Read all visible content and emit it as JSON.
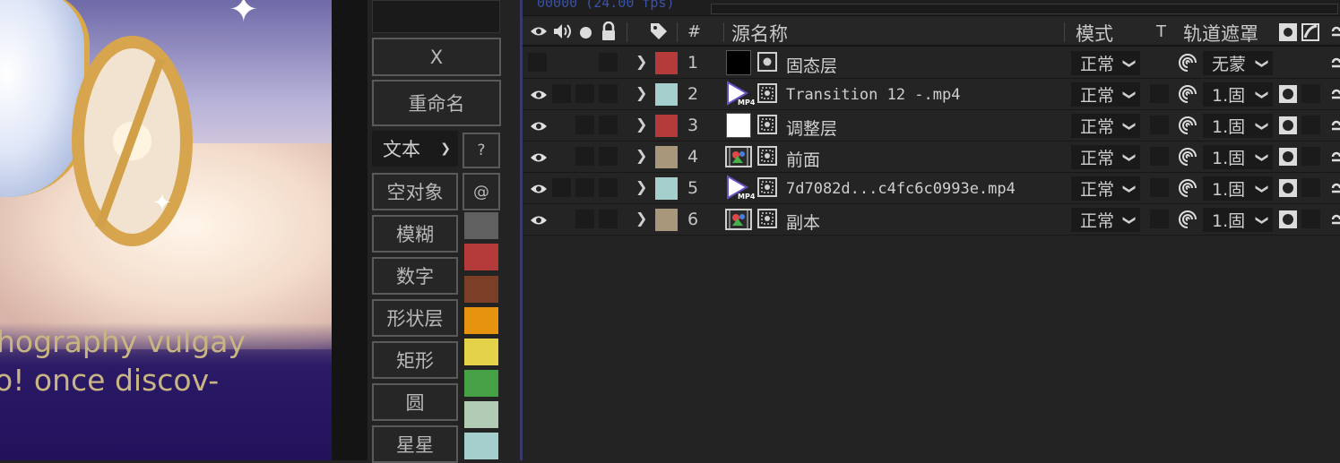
{
  "preview": {
    "overlay_line1": "hography vulgay",
    "overlay_line2": "o! once discov-"
  },
  "tools": {
    "x_label": "X",
    "rename_label": "重命名",
    "text_label": "文本",
    "help_label": "?",
    "at_label": "@",
    "null_label": "空对象",
    "blur_label": "模糊",
    "number_label": "数字",
    "shape_label": "形状层",
    "rect_label": "矩形",
    "circle_label": "圆",
    "star_label": "星星",
    "colors": [
      "#606060",
      "#b53a3a",
      "#7a3f26",
      "#e6930f",
      "#e3d24a",
      "#45a046",
      "#b2cbb4",
      "#a5cfcd"
    ]
  },
  "timeline": {
    "fps_text": "00000 (24.00 fps)",
    "headers": {
      "hash": "#",
      "source_name": "源名称",
      "mode": "模式",
      "t": "T",
      "track_matte": "轨道遮罩"
    },
    "layers": [
      {
        "num": "1",
        "name": "固态层",
        "label_color": "#b53a3a",
        "source": "solid-black",
        "mode": "正常",
        "matte": "无蒙",
        "visible": false,
        "mono": false
      },
      {
        "num": "2",
        "name": "Transition 12 -.mp4",
        "label_color": "#a5cfcd",
        "source": "mp4",
        "mode": "正常",
        "matte": "1.固",
        "visible": true,
        "mono": true
      },
      {
        "num": "3",
        "name": "调整层",
        "label_color": "#b53a3a",
        "source": "solid-white",
        "mode": "正常",
        "matte": "1.固",
        "visible": true,
        "mono": false
      },
      {
        "num": "4",
        "name": "前面",
        "label_color": "#a8977a",
        "source": "image",
        "mode": "正常",
        "matte": "1.固",
        "visible": true,
        "mono": false
      },
      {
        "num": "5",
        "name": "7d7082d...c4fc6c0993e.mp4",
        "label_color": "#a5cfcd",
        "source": "mp4",
        "mode": "正常",
        "matte": "1.固",
        "visible": true,
        "mono": true
      },
      {
        "num": "6",
        "name": "副本",
        "label_color": "#a8977a",
        "source": "image",
        "mode": "正常",
        "matte": "1.固",
        "visible": true,
        "mono": false
      }
    ],
    "mp4_badge": "MP4"
  }
}
